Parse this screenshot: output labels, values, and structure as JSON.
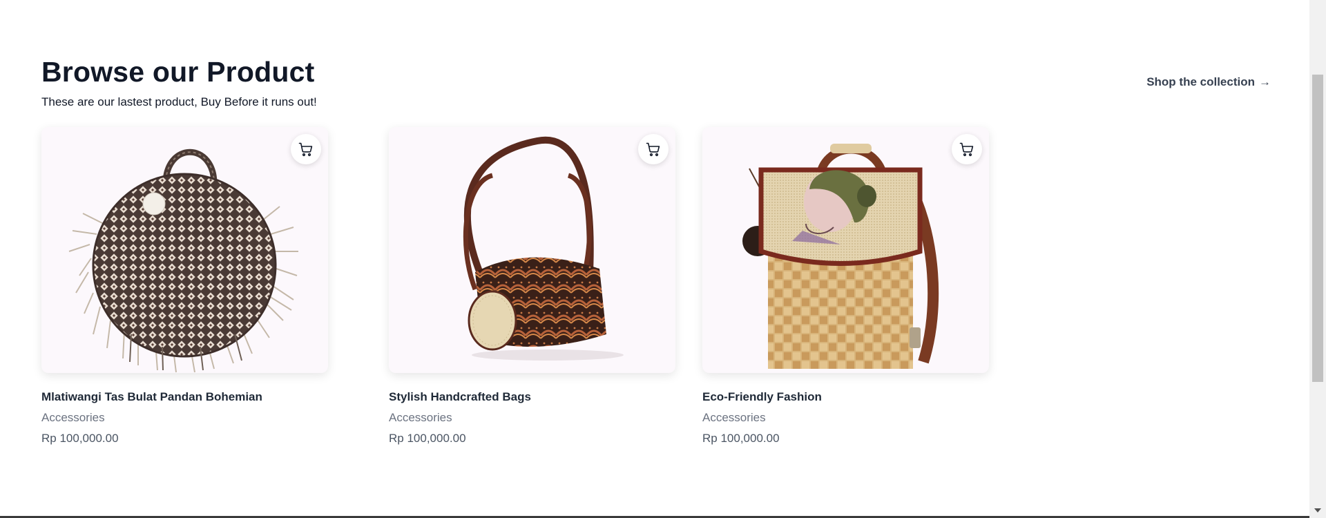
{
  "section": {
    "title": "Browse our Product",
    "subtitle": "These are our lastest product, Buy Before it runs out!",
    "shop_link": "Shop the collection",
    "shop_link_arrow": "→"
  },
  "products": [
    {
      "name": "Mlatiwangi Tas Bulat Pandan Bohemian",
      "category": "Accessories",
      "price": "Rp 100,000.00",
      "image": "round-woven-pandan-bag"
    },
    {
      "name": "Stylish Handcrafted Bags",
      "category": "Accessories",
      "price": "Rp 100,000.00",
      "image": "batik-barrel-handbag"
    },
    {
      "name": "Eco-Friendly Fashion",
      "category": "Accessories",
      "price": "Rp 100,000.00",
      "image": "woven-backpack-portrait"
    }
  ],
  "icons": {
    "cart": "shopping-cart-icon",
    "arrow": "arrow-right-icon"
  },
  "colors": {
    "heading": "#111827",
    "muted": "#6b7280",
    "card_bg": "#fcf8fc"
  }
}
